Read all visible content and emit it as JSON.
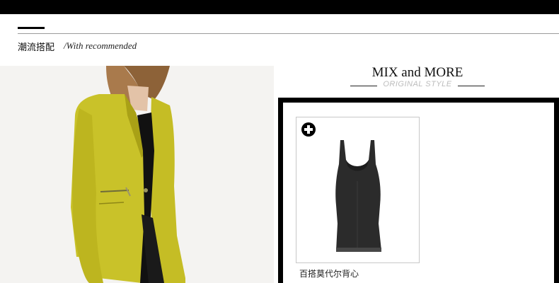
{
  "section": {
    "title_cn": "潮流搭配",
    "title_en": "/With recommended"
  },
  "mix": {
    "title": "MIX and MORE",
    "subtitle": "ORIGINAL STYLE"
  },
  "products": [
    {
      "name": "百搭莫代尔背心",
      "icon": "plus-circle-icon"
    }
  ],
  "colors": {
    "accent": "#000000",
    "blazer": "#c9c229"
  }
}
